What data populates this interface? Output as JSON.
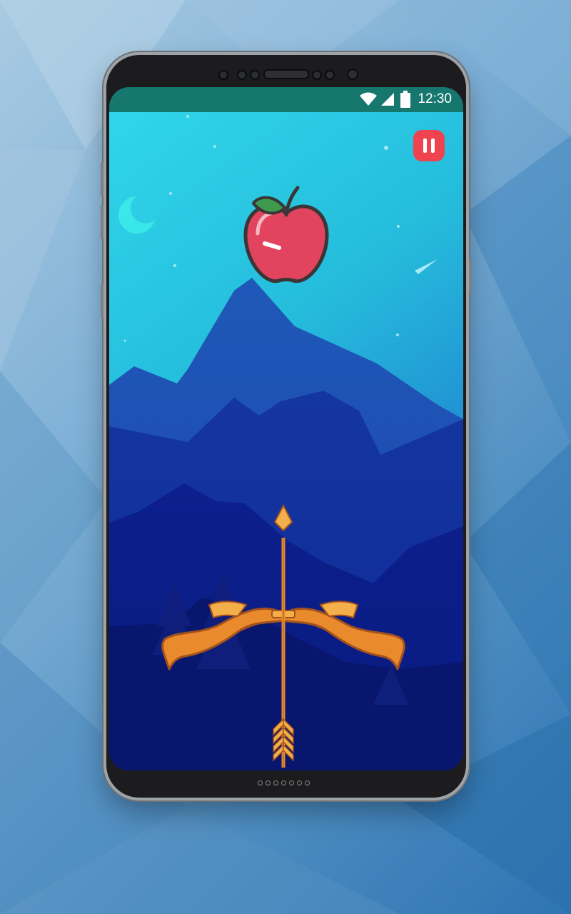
{
  "status_bar": {
    "time": "12:30",
    "icons": [
      "wifi-icon",
      "signal-icon",
      "battery-icon"
    ]
  },
  "game": {
    "target": "apple-icon",
    "weapon": "bow-and-arrow",
    "pause_icon": "pause-icon"
  },
  "colors": {
    "status_bar": "#16776f",
    "sky_top": "#2fd2e6",
    "sky_bottom": "#1f7fcf",
    "pause_button": "#ef4350",
    "apple": "#e2445f",
    "bow": "#e98a2d"
  }
}
